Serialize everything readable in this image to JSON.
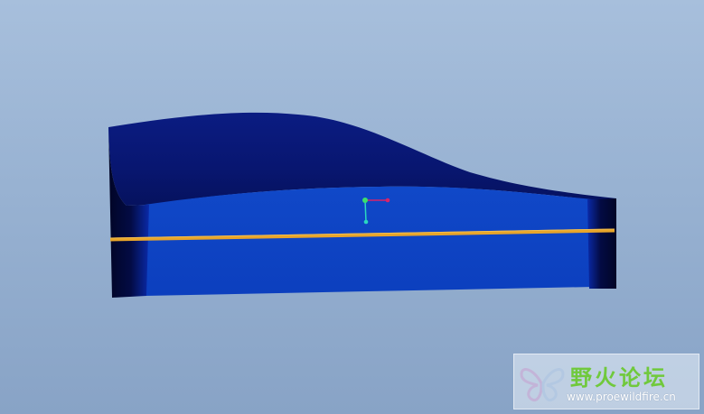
{
  "viewport": {
    "background_top": "#a7bfdc",
    "background_bottom": "#88a3c6"
  },
  "model": {
    "top_surface_color": "#0a1a7a",
    "front_face_color": "#0f43c4",
    "side_shadow_color": "#020a3c",
    "parting_line_color": "#e8a52a"
  },
  "csys": {
    "icon": "coordinate-system-icon",
    "x_axis_color": "#d8246a",
    "y_axis_color": "#2ad8c0",
    "origin_color": "#3ce06a"
  },
  "watermark": {
    "title": "野火论坛",
    "url": "www.proewildfire.cn",
    "title_color": "#70c93c",
    "icon": "butterfly-logo-icon"
  }
}
